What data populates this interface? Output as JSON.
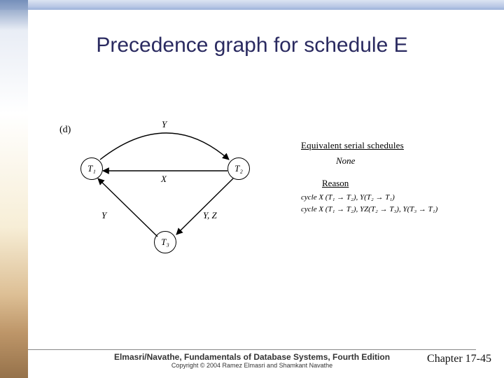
{
  "title": "Precedence graph for schedule E",
  "part_label": "(d)",
  "nodes": {
    "t1": "T₁",
    "t2": "T₂",
    "t3": "T₃"
  },
  "edge_labels": {
    "t1t2_top": "Y",
    "t1t2_mid": "X",
    "t1t3": "Y",
    "t2t3": "Y, Z"
  },
  "right": {
    "schedules_header": "Equivalent serial schedules",
    "schedules_value": "None",
    "reason_header": "Reason",
    "reason1": "cycle X (T₁ → T₂), Y(T₂ → T₁)",
    "reason2": "cycle X (T₁ → T₂), YZ(T₂ → T₃), Y(T₃ → T₁)"
  },
  "footer": {
    "line1": "Elmasri/Navathe, Fundamentals of Database Systems, Fourth Edition",
    "line2": "Copyright © 2004 Ramez Elmasri and Shamkant Navathe"
  },
  "chapter": "Chapter 17-45",
  "chart_data": {
    "type": "graph",
    "directed": true,
    "nodes": [
      "T1",
      "T2",
      "T3"
    ],
    "edges": [
      {
        "from": "T1",
        "to": "T2",
        "label": "Y"
      },
      {
        "from": "T2",
        "to": "T1",
        "label": "X"
      },
      {
        "from": "T3",
        "to": "T1",
        "label": "Y"
      },
      {
        "from": "T2",
        "to": "T3",
        "label": "Y, Z"
      }
    ],
    "title": "Precedence graph for schedule E",
    "annotation": {
      "equivalent_serial_schedules": "None",
      "reasons": [
        "cycle X (T1 → T2), Y(T2 → T1)",
        "cycle X (T1 → T2), YZ(T2 → T3), Y(T3 → T1)"
      ]
    }
  }
}
